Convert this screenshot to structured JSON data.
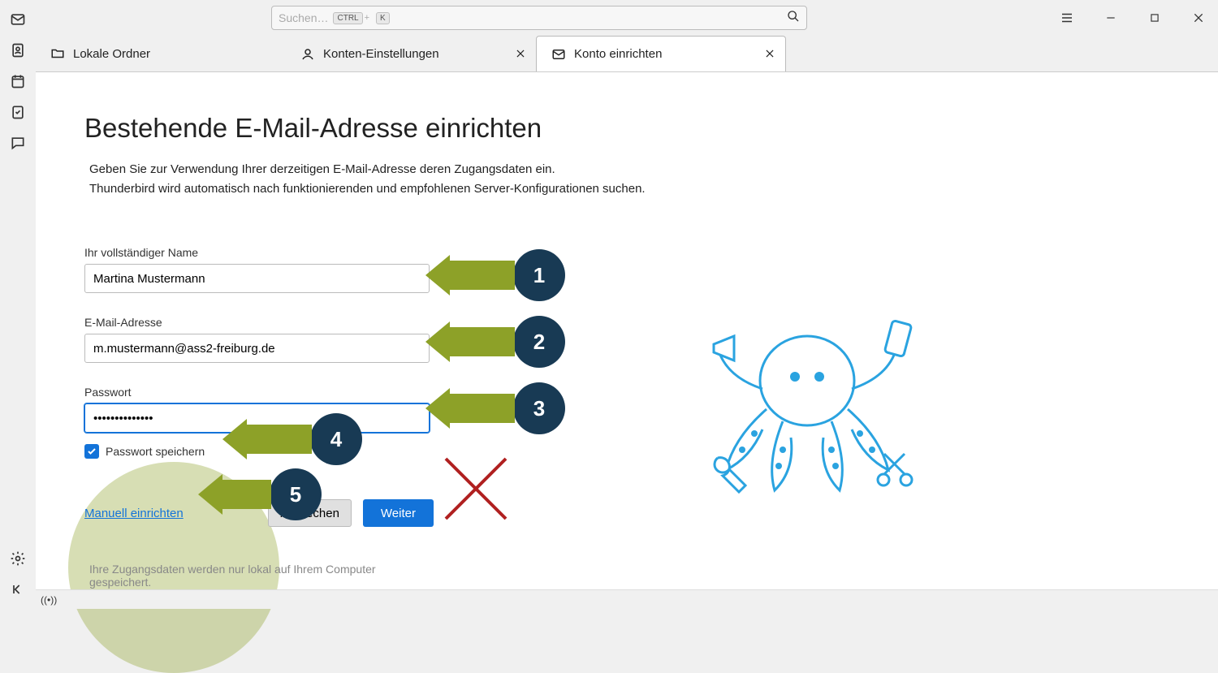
{
  "search": {
    "placeholder": "Suchen…",
    "kbd1": "CTRL",
    "kbd_plus": "+",
    "kbd2": "K"
  },
  "tabs": [
    {
      "label": "Lokale Ordner"
    },
    {
      "label": "Konten-Einstellungen"
    },
    {
      "label": "Konto einrichten"
    }
  ],
  "page": {
    "title": "Bestehende E-Mail-Adresse einrichten",
    "desc1": "Geben Sie zur Verwendung Ihrer derzeitigen E-Mail-Adresse deren Zugangsdaten ein.",
    "desc2": "Thunderbird wird automatisch nach funktionierenden und empfohlenen Server-Konfigurationen suchen."
  },
  "form": {
    "name_label": "Ihr vollständiger Name",
    "name_value": "Martina Mustermann",
    "email_label": "E-Mail-Adresse",
    "email_value": "m.mustermann@ass2-freiburg.de",
    "password_label": "Passwort",
    "password_value": "••••••••••••••",
    "remember_label": "Passwort speichern",
    "manual_link": "Manuell einrichten",
    "cancel": "Abbrechen",
    "next": "Weiter",
    "footnote": "Ihre Zugangsdaten werden nur lokal auf Ihrem Computer gespeichert."
  },
  "annotations": {
    "n1": "1",
    "n2": "2",
    "n3": "3",
    "n4": "4",
    "n5": "5"
  },
  "status": {
    "sync": "((•))"
  }
}
